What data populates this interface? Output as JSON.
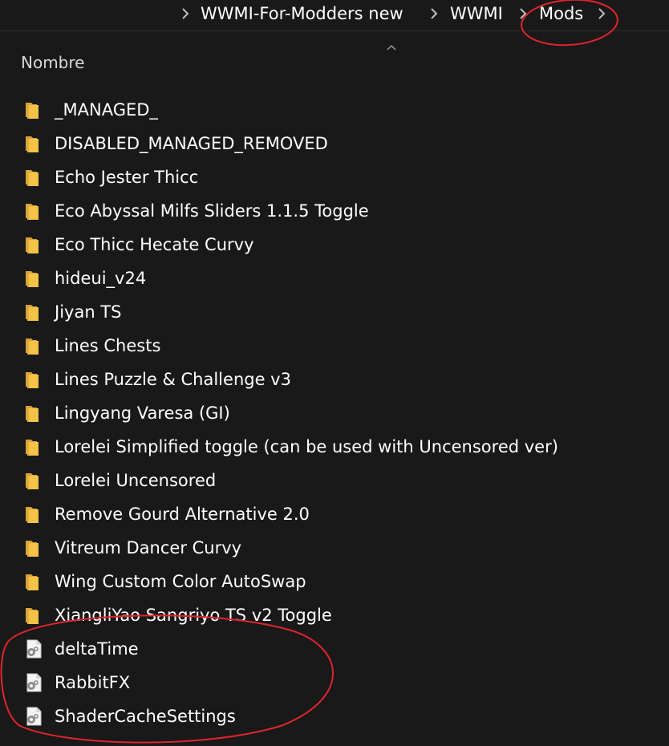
{
  "breadcrumb": {
    "items": [
      "WWMI-For-Modders new",
      "WWMI",
      "Mods"
    ]
  },
  "columns": {
    "name_header": "Nombre"
  },
  "files": [
    {
      "name": "_MANAGED_",
      "type": "folder"
    },
    {
      "name": "DISABLED_MANAGED_REMOVED",
      "type": "folder"
    },
    {
      "name": "Echo Jester Thicc",
      "type": "folder"
    },
    {
      "name": "Eco Abyssal Milfs Sliders 1.1.5 Toggle",
      "type": "folder"
    },
    {
      "name": "Eco Thicc Hecate Curvy",
      "type": "folder"
    },
    {
      "name": "hideui_v24",
      "type": "folder"
    },
    {
      "name": "Jiyan TS",
      "type": "folder"
    },
    {
      "name": "Lines Chests",
      "type": "folder"
    },
    {
      "name": "Lines Puzzle & Challenge v3",
      "type": "folder"
    },
    {
      "name": "Lingyang Varesa (GI)",
      "type": "folder"
    },
    {
      "name": "Lorelei Simplified toggle (can be used with Uncensored ver)",
      "type": "folder"
    },
    {
      "name": "Lorelei Uncensored",
      "type": "folder"
    },
    {
      "name": "Remove Gourd Alternative 2.0",
      "type": "folder"
    },
    {
      "name": "Vitreum Dancer Curvy",
      "type": "folder"
    },
    {
      "name": "Wing Custom Color AutoSwap",
      "type": "folder"
    },
    {
      "name": "XiangliYao Sangriyo TS v2 Toggle",
      "type": "folder"
    },
    {
      "name": "deltaTime",
      "type": "settings-file"
    },
    {
      "name": "RabbitFX",
      "type": "settings-file"
    },
    {
      "name": "ShaderCacheSettings",
      "type": "settings-file"
    }
  ],
  "colors": {
    "background": "#191919",
    "text": "#ffffff",
    "folder": "#f3c246",
    "annotation": "#e0242c"
  },
  "icons": {
    "folder": "folder-icon",
    "settings_file": "settings-file-icon",
    "separator": "chevron-right-icon",
    "sort": "sort-ascending-icon"
  }
}
